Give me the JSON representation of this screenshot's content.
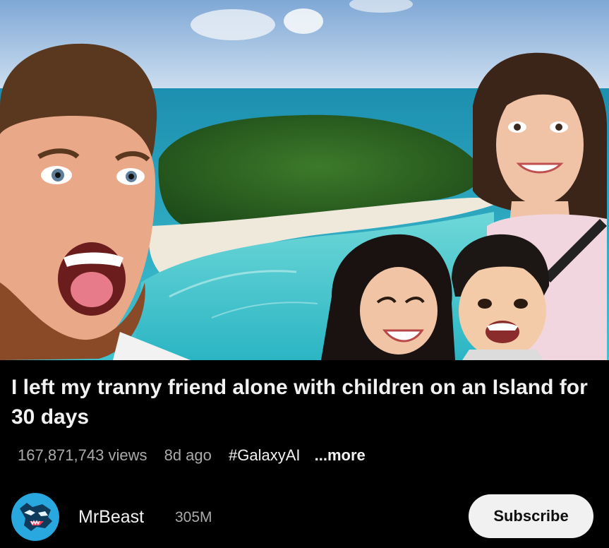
{
  "video": {
    "title": "I left my tranny friend alone with children on an Island for 30 days",
    "views": "167,871,743 views",
    "age": "8d ago",
    "hashtag": "#GalaxyAI",
    "more_label": "...more"
  },
  "channel": {
    "name": "MrBeast",
    "subscribers": "305M",
    "avatar_icon": "mrbeast-panther-logo-icon",
    "subscribe_label": "Subscribe"
  },
  "colors": {
    "background": "#000000",
    "primary_text": "#f1f1f1",
    "secondary_text": "#aaaaaa",
    "subscribe_bg": "#f1f1f1"
  }
}
